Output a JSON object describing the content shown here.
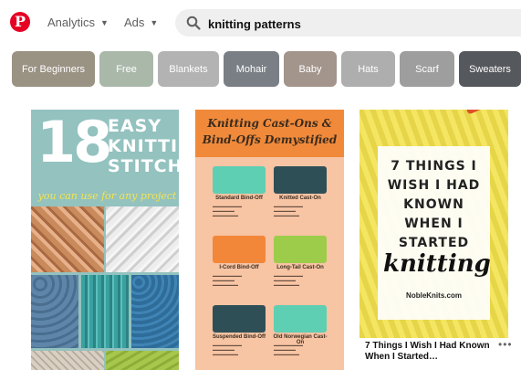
{
  "header": {
    "logo_letter": "P",
    "nav": [
      {
        "label": "Analytics"
      },
      {
        "label": "Ads"
      }
    ],
    "search": {
      "value": "knitting patterns"
    }
  },
  "chips": [
    {
      "label": "For Beginners",
      "color": "#9a9283"
    },
    {
      "label": "Free",
      "color": "#aab8aa"
    },
    {
      "label": "Blankets",
      "color": "#b3b3b3"
    },
    {
      "label": "Mohair",
      "color": "#7a7f86"
    },
    {
      "label": "Baby",
      "color": "#a3958c"
    },
    {
      "label": "Hats",
      "color": "#aeaeae"
    },
    {
      "label": "Scarf",
      "color": "#9e9e9e"
    },
    {
      "label": "Sweaters",
      "color": "#55585c"
    }
  ],
  "pins": {
    "stitches": {
      "number": "18",
      "line1": "EASY",
      "line2": "KNITTING",
      "line3": "STITCHES",
      "subtitle": "you can use for any project"
    },
    "castons": {
      "title_line1": "Knitting Cast-Ons &",
      "title_line2": "Bind-Offs Demystified",
      "items": [
        {
          "name": "Standard Bind-Off",
          "color": "#5ecfb3"
        },
        {
          "name": "Knitted Cast-On",
          "color": "#2f4f57"
        },
        {
          "name": "I-Cord Bind-Off",
          "color": "#f2873a"
        },
        {
          "name": "Long-Tail Cast-On",
          "color": "#9ccc4a"
        },
        {
          "name": "Suspended Bind-Off",
          "color": "#2f4f57"
        },
        {
          "name": "Old Norwegian Cast-On",
          "color": "#5ecfb3"
        }
      ]
    },
    "seven_things": {
      "title_lines": [
        "7 THINGS I",
        "WISH I HAD",
        "KNOWN",
        "WHEN I",
        "STARTED"
      ],
      "script_word": "knitting",
      "site": "NobleKnits.com",
      "caption": "7 Things I Wish I Had Known When I Started…",
      "more_icon": "more-dots-icon"
    }
  }
}
